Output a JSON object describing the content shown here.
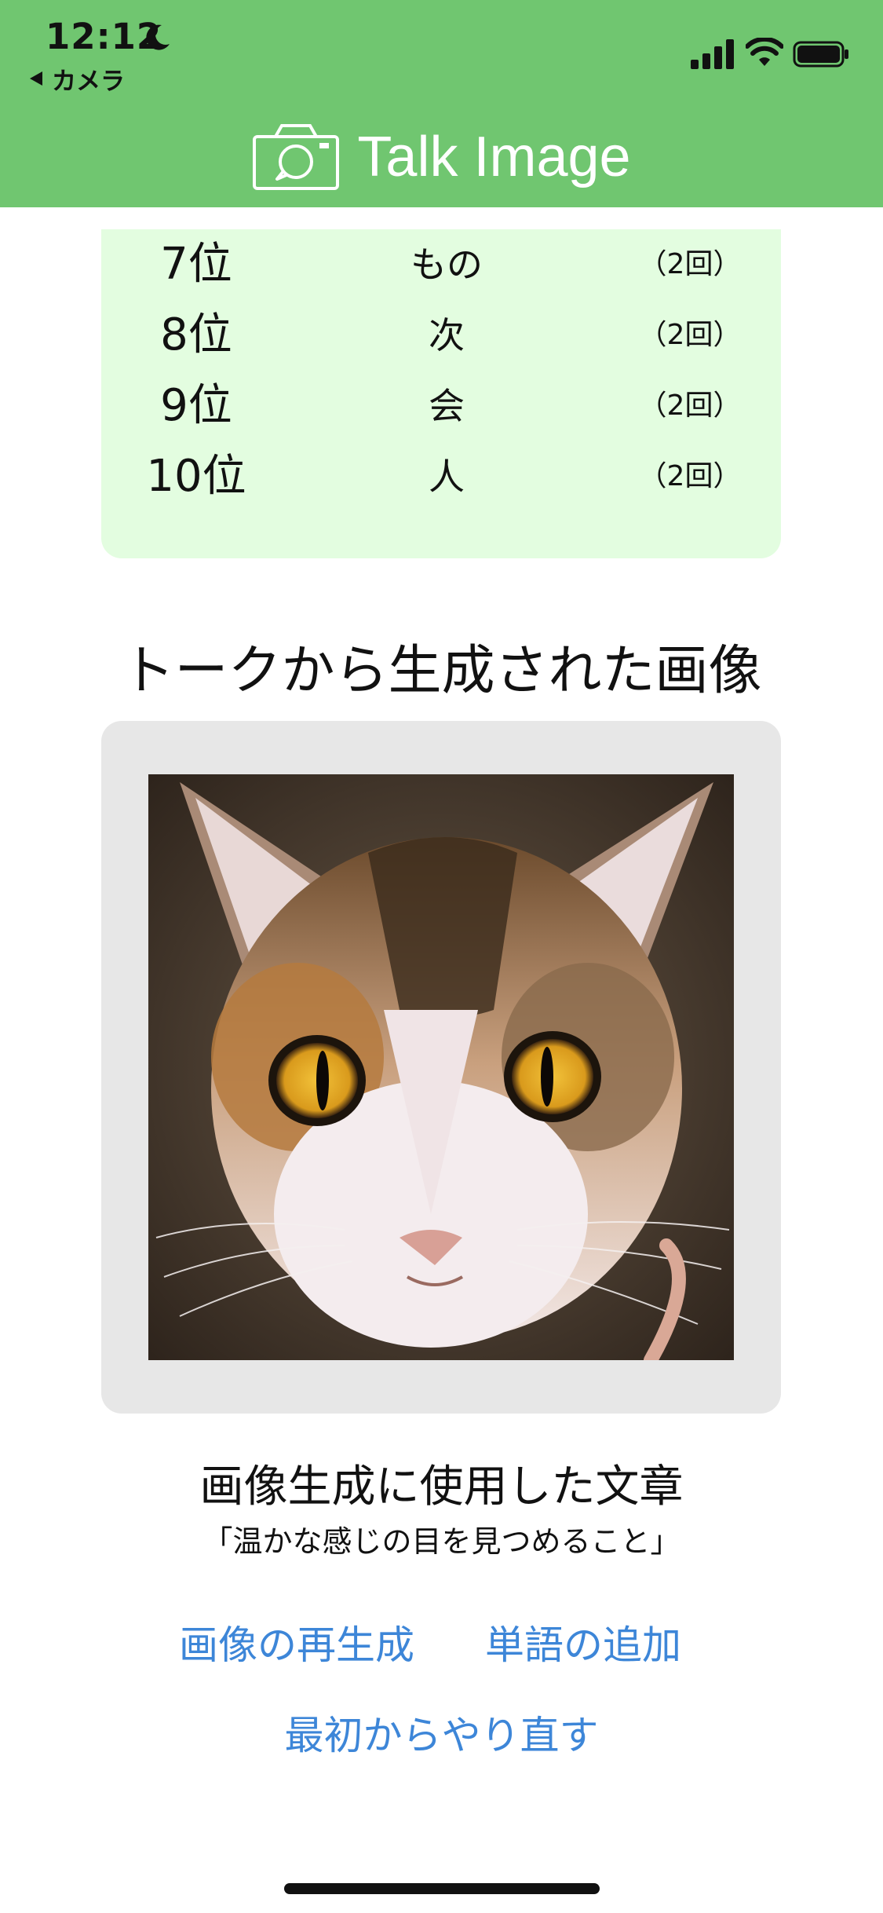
{
  "status_bar": {
    "time": "12:12",
    "back_label": "カメラ"
  },
  "header": {
    "title": "Talk Image",
    "background": "#70c670"
  },
  "ranking": {
    "rows": [
      {
        "position": "7位",
        "word": "もの",
        "count": "（2回）"
      },
      {
        "position": "8位",
        "word": "次",
        "count": "（2回）"
      },
      {
        "position": "9位",
        "word": "会",
        "count": "（2回）"
      },
      {
        "position": "10位",
        "word": "人",
        "count": "（2回）"
      }
    ],
    "background": "#e3fde0"
  },
  "generated": {
    "section_title": "トークから生成された画像",
    "source_title": "画像生成に使用した文章",
    "source_text": "「温かな感じの目を見つめること」"
  },
  "actions": {
    "regenerate_label": "画像の再生成",
    "add_word_label": "単語の追加",
    "restart_label": "最初からやり直す",
    "link_color": "#3d86d8"
  }
}
